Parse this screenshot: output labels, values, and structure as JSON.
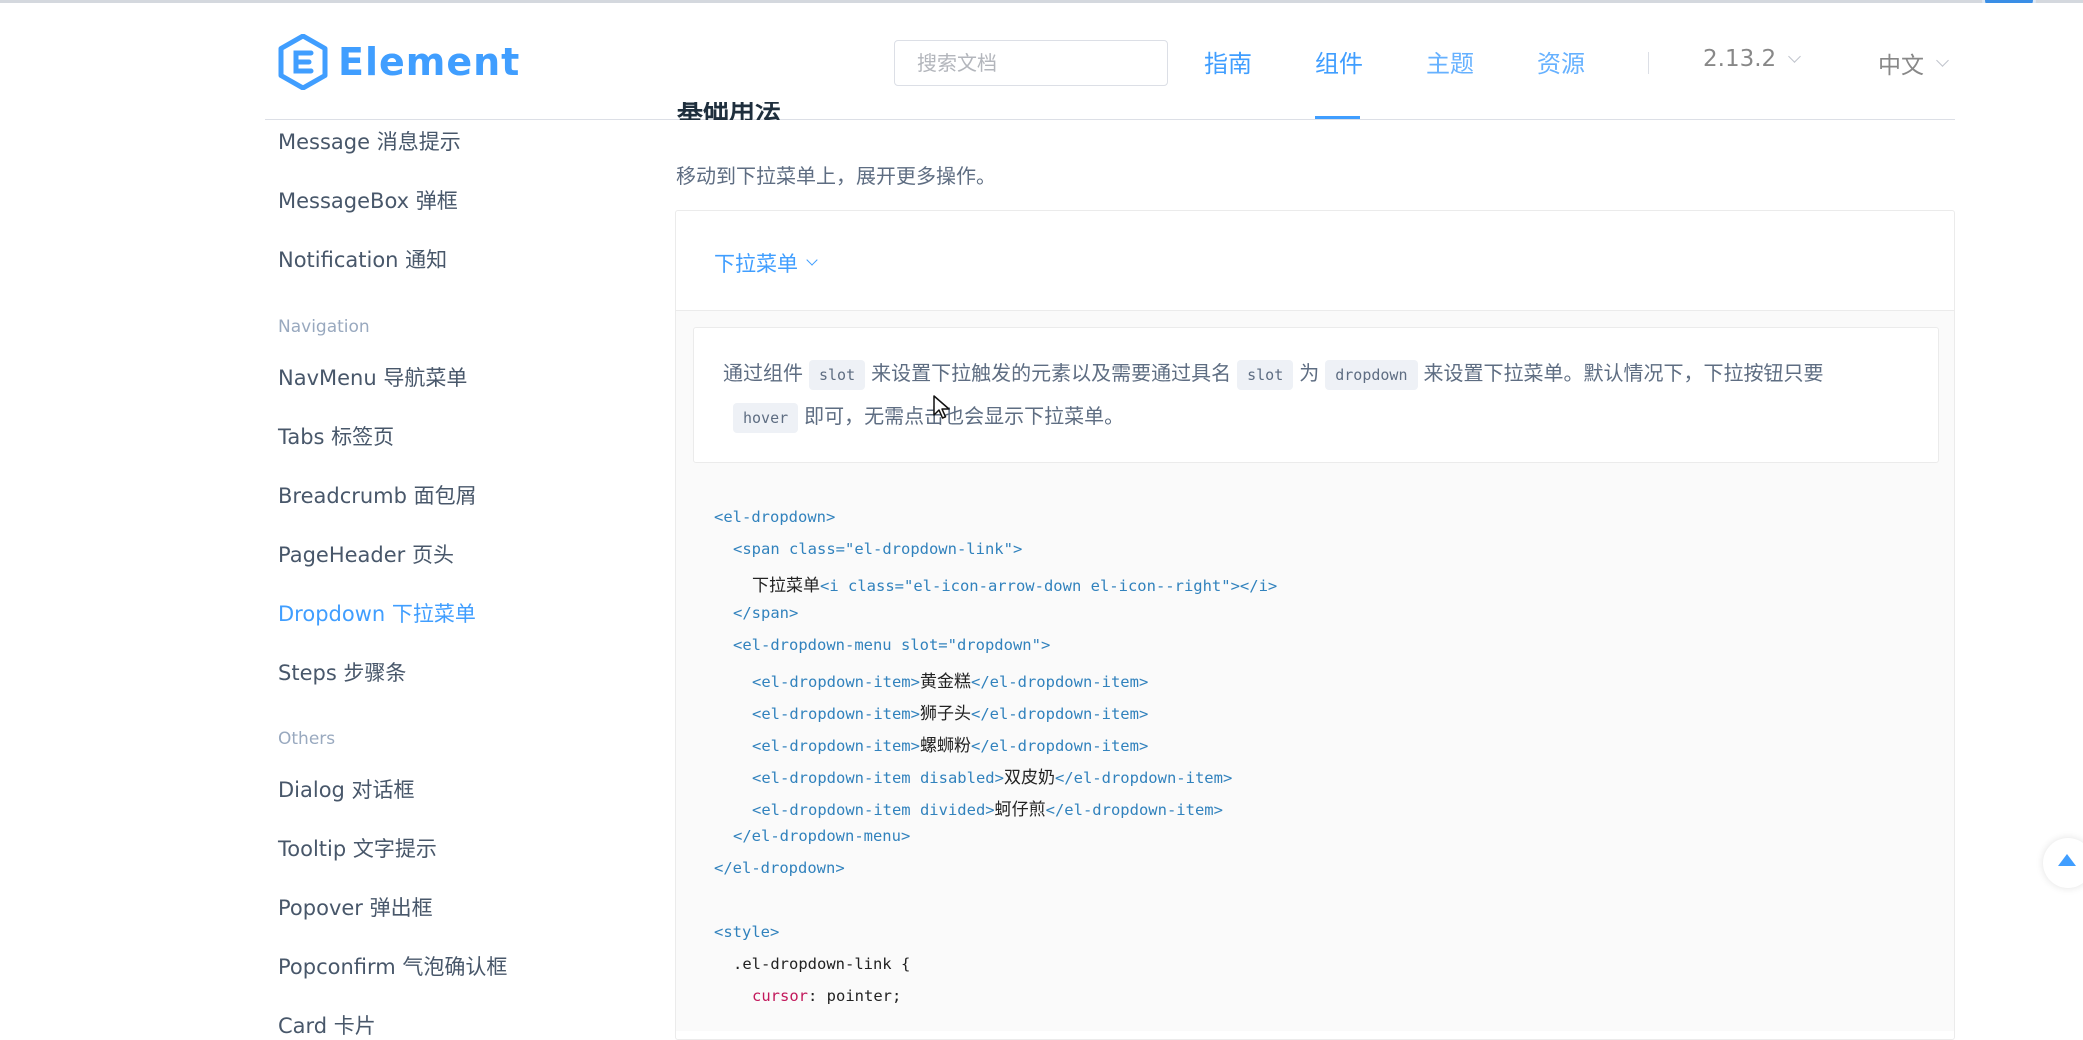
{
  "header": {
    "logo_text": "Element",
    "search_placeholder": "搜索文档",
    "nav": [
      {
        "label": "指南"
      },
      {
        "label": "组件"
      },
      {
        "label": "主题"
      },
      {
        "label": "资源"
      }
    ],
    "version": "2.13.2",
    "language": "中文"
  },
  "sidebar": {
    "items_top": [
      {
        "label": "Message 消息提示"
      },
      {
        "label": "MessageBox 弹框"
      },
      {
        "label": "Notification 通知"
      }
    ],
    "group_navigation": "Navigation",
    "items_navigation": [
      {
        "label": "NavMenu 导航菜单"
      },
      {
        "label": "Tabs 标签页"
      },
      {
        "label": "Breadcrumb 面包屑"
      },
      {
        "label": "PageHeader 页头"
      },
      {
        "label": "Dropdown 下拉菜单"
      },
      {
        "label": "Steps 步骤条"
      }
    ],
    "group_others": "Others",
    "items_others": [
      {
        "label": "Dialog 对话框"
      },
      {
        "label": "Tooltip 文字提示"
      },
      {
        "label": "Popover 弹出框"
      },
      {
        "label": "Popconfirm 气泡确认框"
      },
      {
        "label": "Card 卡片"
      }
    ]
  },
  "main": {
    "section_title": "基础用法",
    "description": "移动到下拉菜单上，展开更多操作。",
    "demo_trigger": "下拉菜单",
    "explain": {
      "p1": "通过组件",
      "chip1": "slot",
      "p2": "来设置下拉触发的元素以及需要通过具名",
      "chip2": "slot",
      "p3": "为",
      "chip3": "dropdown",
      "p4": "来设置下拉菜单。默认情况下，下拉按钮只要",
      "chip4": "hover",
      "p5": "即可，无需点击也会显示下拉菜单。"
    },
    "code": {
      "l1": "<el-dropdown>",
      "l2a": "<span ",
      "l2b": "class=\"el-dropdown-link\"",
      "l2c": ">",
      "l3a": "下拉菜单",
      "l3b": "<i class=\"el-icon-arrow-down el-icon--right\"></i>",
      "l4": "</span>",
      "l5": "<el-dropdown-menu slot=\"dropdown\">",
      "l6a": "<el-dropdown-item>",
      "l6b": "黄金糕",
      "l6c": "</el-dropdown-item>",
      "l7a": "<el-dropdown-item>",
      "l7b": "狮子头",
      "l7c": "</el-dropdown-item>",
      "l8a": "<el-dropdown-item>",
      "l8b": "螺蛳粉",
      "l8c": "</el-dropdown-item>",
      "l9a": "<el-dropdown-item disabled>",
      "l9b": "双皮奶",
      "l9c": "</el-dropdown-item>",
      "l10a": "<el-dropdown-item divided>",
      "l10b": "蚵仔煎",
      "l10c": "</el-dropdown-item>",
      "l11": "</el-dropdown-menu>",
      "l12": "</el-dropdown>",
      "l13": "<style>",
      "l14": ".el-dropdown-link {",
      "l15a": "cursor",
      "l15b": ": pointer;"
    }
  },
  "colors": {
    "primary": "#409eff",
    "text": "#5e6d82",
    "sidebar_text": "#48576a",
    "code_tag": "#3182bd",
    "code_prop": "#c2185b"
  },
  "icons": [
    "element-logo-icon",
    "chevron-down-icon",
    "back-to-top-icon",
    "cursor-icon"
  ]
}
